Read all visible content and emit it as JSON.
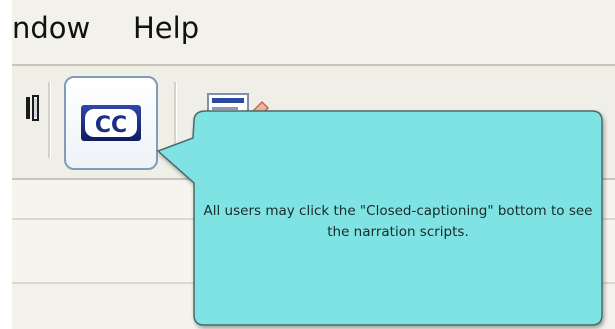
{
  "menubar": {
    "items": [
      {
        "label": "ndow"
      },
      {
        "label": "Help"
      }
    ]
  },
  "toolbar": {
    "cc_button": {
      "icon_text": "CC"
    }
  },
  "callout": {
    "text": "All users may click the \"Closed-captioning\" bottom to see the narration scripts."
  },
  "colors": {
    "callout_fill": "#7ee3e2",
    "callout_border": "#4a6a6a",
    "cc_icon_navy": "#1b2d86",
    "window_gray": "#ece9d8"
  },
  "icons": {
    "partial_icon": "toolbar-partial-icon",
    "cc_icon": "closed-captioning-icon",
    "script_icon": "narration-script-icon"
  }
}
